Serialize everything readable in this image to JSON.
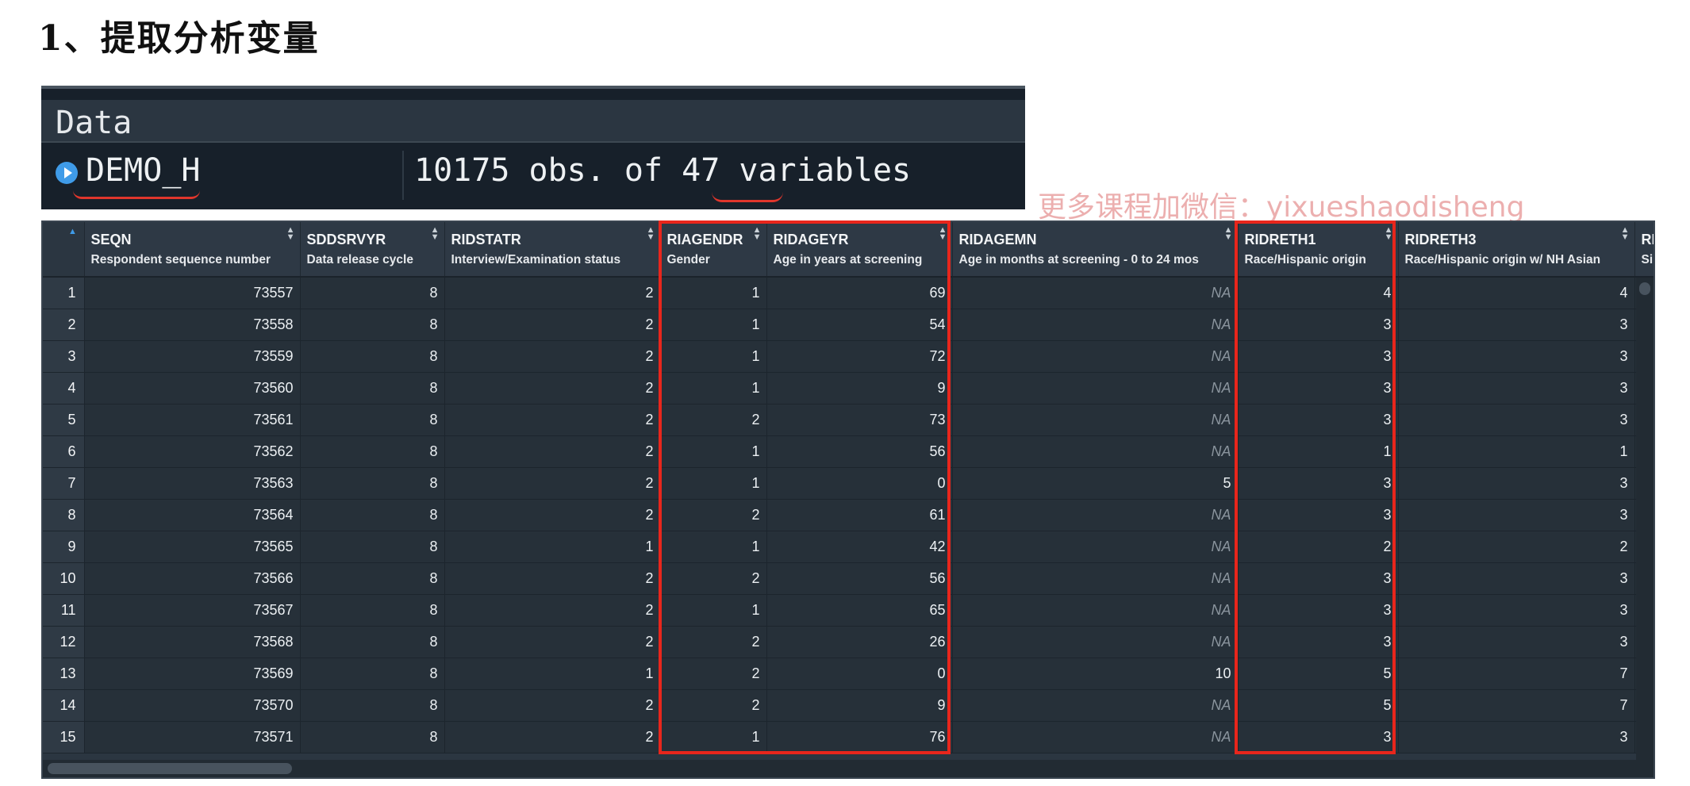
{
  "slide": {
    "title": "1、提取分析变量"
  },
  "environment": {
    "section": "Data",
    "object_name": "DEMO_H",
    "object_desc": "10175 obs. of 47 variables",
    "expand_icon": "play-circle-icon"
  },
  "watermark": "更多课程加微信：yixueshaodisheng",
  "grid": {
    "columns": [
      {
        "name": "SEQN",
        "label": "Respondent sequence number"
      },
      {
        "name": "SDDSRVYR",
        "label": "Data release cycle"
      },
      {
        "name": "RIDSTATR",
        "label": "Interview/Examination status"
      },
      {
        "name": "RIAGENDR",
        "label": "Gender"
      },
      {
        "name": "RIDAGEYR",
        "label": "Age in years at screening"
      },
      {
        "name": "RIDAGEMN",
        "label": "Age in months at screening - 0 to 24 mos"
      },
      {
        "name": "RIDRETH1",
        "label": "Race/Hispanic origin"
      },
      {
        "name": "RIDRETH3",
        "label": "Race/Hispanic origin w/ NH Asian"
      },
      {
        "name": "RI",
        "label": "Si"
      }
    ],
    "row_numbers": [
      "1",
      "2",
      "3",
      "4",
      "5",
      "6",
      "7",
      "8",
      "9",
      "10",
      "11",
      "12",
      "13",
      "14",
      "15"
    ],
    "rows": [
      [
        "73557",
        "8",
        "2",
        "1",
        "69",
        "NA",
        "4",
        "4",
        ""
      ],
      [
        "73558",
        "8",
        "2",
        "1",
        "54",
        "NA",
        "3",
        "3",
        ""
      ],
      [
        "73559",
        "8",
        "2",
        "1",
        "72",
        "NA",
        "3",
        "3",
        ""
      ],
      [
        "73560",
        "8",
        "2",
        "1",
        "9",
        "NA",
        "3",
        "3",
        ""
      ],
      [
        "73561",
        "8",
        "2",
        "2",
        "73",
        "NA",
        "3",
        "3",
        ""
      ],
      [
        "73562",
        "8",
        "2",
        "1",
        "56",
        "NA",
        "1",
        "1",
        ""
      ],
      [
        "73563",
        "8",
        "2",
        "1",
        "0",
        "5",
        "3",
        "3",
        ""
      ],
      [
        "73564",
        "8",
        "2",
        "2",
        "61",
        "NA",
        "3",
        "3",
        ""
      ],
      [
        "73565",
        "8",
        "1",
        "1",
        "42",
        "NA",
        "2",
        "2",
        ""
      ],
      [
        "73566",
        "8",
        "2",
        "2",
        "56",
        "NA",
        "3",
        "3",
        ""
      ],
      [
        "73567",
        "8",
        "2",
        "1",
        "65",
        "NA",
        "3",
        "3",
        ""
      ],
      [
        "73568",
        "8",
        "2",
        "2",
        "26",
        "NA",
        "3",
        "3",
        ""
      ],
      [
        "73569",
        "8",
        "1",
        "2",
        "0",
        "10",
        "5",
        "7",
        ""
      ],
      [
        "73570",
        "8",
        "2",
        "2",
        "9",
        "NA",
        "5",
        "7",
        ""
      ],
      [
        "73571",
        "8",
        "2",
        "1",
        "76",
        "NA",
        "3",
        "3",
        ""
      ]
    ]
  },
  "colors": {
    "highlight": "#e8261c",
    "na_text": "#8a949d",
    "accent": "#3f9be8"
  }
}
